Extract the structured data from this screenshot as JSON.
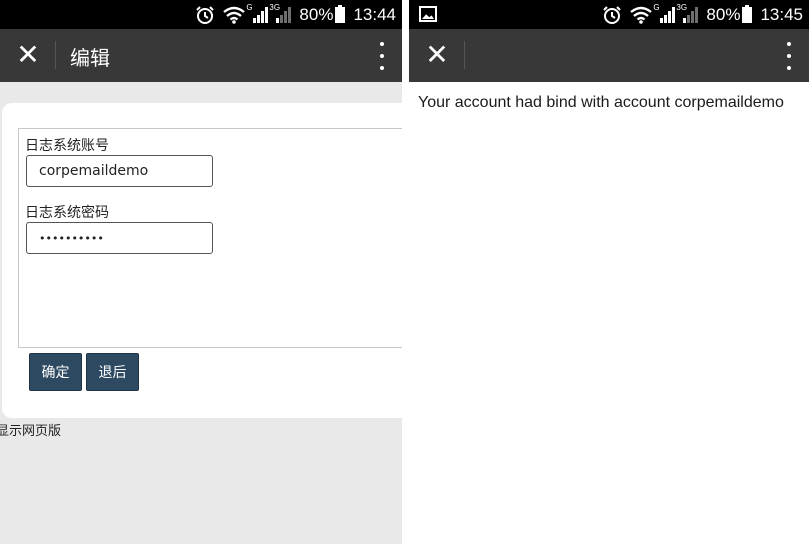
{
  "left_screen": {
    "status": {
      "battery": "80%",
      "time": "13:44",
      "net_g": "G",
      "net_3g": "3G"
    },
    "header": {
      "title": "编辑"
    },
    "form": {
      "account_label": "日志系统账号",
      "account_value": "corpemaildemo",
      "password_label": "日志系统密码",
      "password_value": "••••••••••"
    },
    "buttons": {
      "confirm": "确定",
      "back": "退后"
    },
    "footer": {
      "desktop_link": "显示网页版"
    }
  },
  "right_screen": {
    "status": {
      "battery": "80%",
      "time": "13:45",
      "net_g": "G",
      "net_3g": "3G"
    },
    "message": "Your account had bind with account corpemaildemo"
  },
  "icons": {
    "status": [
      "alarm-icon",
      "wifi-icon",
      "signal-icon",
      "battery-icon"
    ],
    "header": [
      "close-icon",
      "more-icon"
    ],
    "right_status_extra": "image-notification-icon"
  },
  "colors": {
    "status_bar": "#000000",
    "title_bar": "#383838",
    "button": "#2e4a62",
    "page_bg": "#e9e9e9"
  }
}
